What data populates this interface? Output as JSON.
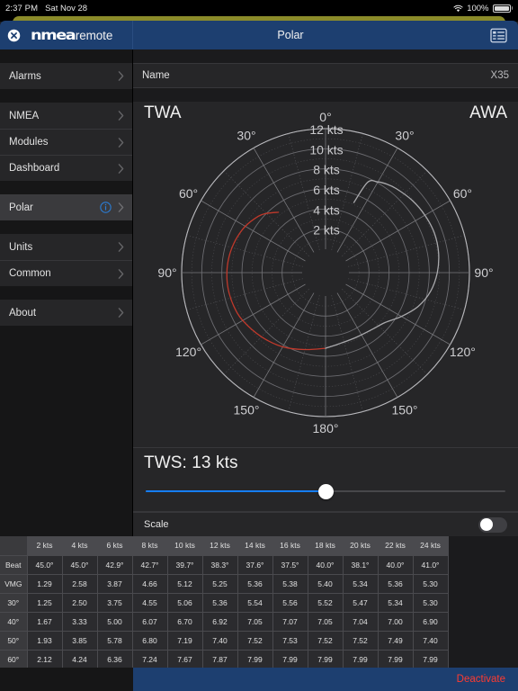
{
  "statusbar": {
    "time": "2:37 PM",
    "date": "Sat Nov 28",
    "battery_percent": "100%",
    "wifi_icon": "wifi-icon",
    "battery_icon": "battery-full-icon"
  },
  "navbar": {
    "close_icon": "close-circle-icon",
    "logo_primary": "nmea",
    "logo_secondary": "remote",
    "title": "Polar",
    "list_icon": "list-view-icon"
  },
  "sidebar": {
    "groups": [
      {
        "items": [
          {
            "label": "Alarms",
            "selected": false,
            "info": false
          }
        ]
      },
      {
        "items": [
          {
            "label": "NMEA",
            "selected": false,
            "info": false
          },
          {
            "label": "Modules",
            "selected": false,
            "info": false
          },
          {
            "label": "Dashboard",
            "selected": false,
            "info": false
          }
        ]
      },
      {
        "items": [
          {
            "label": "Polar",
            "selected": true,
            "info": true
          }
        ]
      },
      {
        "items": [
          {
            "label": "Units",
            "selected": false,
            "info": false
          },
          {
            "label": "Common",
            "selected": false,
            "info": false
          }
        ]
      },
      {
        "items": [
          {
            "label": "About",
            "selected": false,
            "info": false
          }
        ]
      }
    ]
  },
  "main": {
    "name_row": {
      "label": "Name",
      "value": "X35"
    },
    "tws": {
      "label": "TWS: 13 kts",
      "value": 13,
      "min": 2,
      "max": 24,
      "fill_percent": 55
    },
    "scale": {
      "label": "Scale",
      "enabled": false
    }
  },
  "bottombar": {
    "deactivate_label": "Deactivate"
  },
  "chart_data": {
    "type": "polar",
    "title_left": "TWA",
    "title_right": "AWA",
    "angle_labels_left": [
      "0°",
      "30°",
      "60°",
      "90°",
      "120°",
      "150°",
      "180°"
    ],
    "angle_labels_right": [
      "0°",
      "30°",
      "60°",
      "90°",
      "120°",
      "150°",
      "180°"
    ],
    "radial_labels": [
      "2 kts",
      "4 kts",
      "6 kts",
      "8 kts",
      "10 kts",
      "12 kts"
    ],
    "radial_max": 12,
    "radial_step": 2,
    "series": [
      {
        "name": "TWA",
        "color": "#c0392b",
        "side": "left",
        "points": [
          {
            "angle": 38,
            "speed": 5.3
          },
          {
            "angle": 45,
            "speed": 6.0
          },
          {
            "angle": 50,
            "speed": 6.4
          },
          {
            "angle": 60,
            "speed": 6.9
          },
          {
            "angle": 70,
            "speed": 7.2
          },
          {
            "angle": 80,
            "speed": 7.4
          },
          {
            "angle": 90,
            "speed": 7.5
          },
          {
            "angle": 100,
            "speed": 7.5
          },
          {
            "angle": 110,
            "speed": 7.4
          },
          {
            "angle": 120,
            "speed": 7.2
          },
          {
            "angle": 135,
            "speed": 6.7
          },
          {
            "angle": 150,
            "speed": 6.2
          },
          {
            "angle": 165,
            "speed": 5.6
          },
          {
            "angle": 180,
            "speed": 5.2
          }
        ]
      },
      {
        "name": "AWA",
        "color": "#a9a9ac",
        "side": "right",
        "points": [
          {
            "angle": 22,
            "speed": 5.2
          },
          {
            "angle": 25,
            "speed": 7.6
          },
          {
            "angle": 30,
            "speed": 8.1
          },
          {
            "angle": 35,
            "speed": 8.4
          },
          {
            "angle": 40,
            "speed": 8.6
          },
          {
            "angle": 50,
            "speed": 8.9
          },
          {
            "angle": 60,
            "speed": 9.1
          },
          {
            "angle": 70,
            "speed": 9.2
          },
          {
            "angle": 80,
            "speed": 9.1
          },
          {
            "angle": 90,
            "speed": 8.8
          },
          {
            "angle": 100,
            "speed": 8.3
          },
          {
            "angle": 110,
            "speed": 7.5
          },
          {
            "angle": 120,
            "speed": 6.4
          },
          {
            "angle": 130,
            "speed": 5.4
          },
          {
            "angle": 140,
            "speed": 5.0
          },
          {
            "angle": 155,
            "speed": 4.8
          },
          {
            "angle": 170,
            "speed": 4.9
          },
          {
            "angle": 180,
            "speed": 5.2
          }
        ]
      }
    ]
  },
  "table": {
    "corner": "",
    "columns": [
      "2 kts",
      "4 kts",
      "6 kts",
      "8 kts",
      "10 kts",
      "12 kts",
      "14 kts",
      "16 kts",
      "18 kts",
      "20 kts",
      "22 kts",
      "24 kts"
    ],
    "rows": [
      {
        "head": "Beat",
        "cells": [
          "45.0°",
          "45.0°",
          "42.9°",
          "42.7°",
          "39.7°",
          "38.3°",
          "37.6°",
          "37.5°",
          "40.0°",
          "38.1°",
          "40.0°",
          "41.0°"
        ]
      },
      {
        "head": "VMG",
        "cells": [
          "1.29",
          "2.58",
          "3.87",
          "4.66",
          "5.12",
          "5.25",
          "5.36",
          "5.38",
          "5.40",
          "5.34",
          "5.36",
          "5.30"
        ]
      },
      {
        "head": "30°",
        "cells": [
          "1.25",
          "2.50",
          "3.75",
          "4.55",
          "5.06",
          "5.36",
          "5.54",
          "5.56",
          "5.52",
          "5.47",
          "5.34",
          "5.30"
        ]
      },
      {
        "head": "40°",
        "cells": [
          "1.67",
          "3.33",
          "5.00",
          "6.07",
          "6.70",
          "6.92",
          "7.05",
          "7.07",
          "7.05",
          "7.04",
          "7.00",
          "6.90"
        ]
      },
      {
        "head": "50°",
        "cells": [
          "1.93",
          "3.85",
          "5.78",
          "6.80",
          "7.19",
          "7.40",
          "7.52",
          "7.53",
          "7.52",
          "7.52",
          "7.49",
          "7.40"
        ]
      },
      {
        "head": "60°",
        "cells": [
          "2.12",
          "4.24",
          "6.36",
          "7.24",
          "7.67",
          "7.87",
          "7.99",
          "7.99",
          "7.99",
          "7.99",
          "7.99",
          "7.99"
        ]
      }
    ]
  },
  "colors": {
    "nav_blue": "#1d3f70",
    "accent_blue": "#157efb",
    "danger_red": "#ff3b30",
    "twa_red": "#c0392b",
    "awa_gray": "#a9a9ac",
    "panel": "#262628",
    "page_bg": "#1b1b1d"
  }
}
